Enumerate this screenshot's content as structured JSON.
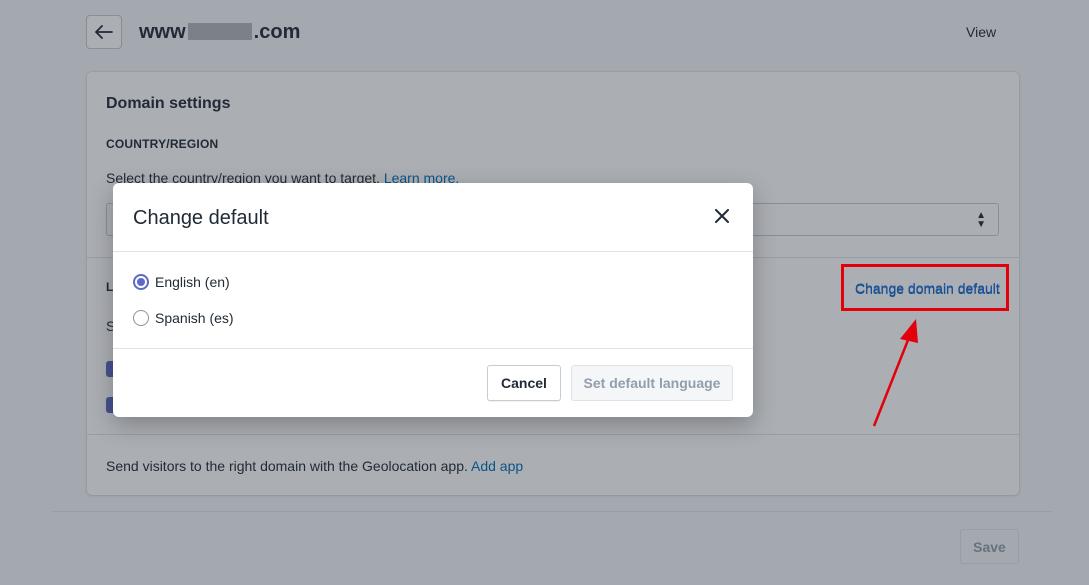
{
  "header": {
    "title_prefix": "www",
    "title_suffix": ".com",
    "view_label": "View"
  },
  "card": {
    "title": "Domain settings",
    "country_label": "COUNTRY/REGION",
    "country_text": "Select the country/region you want to target.",
    "learn_more": "Learn more.",
    "language_label_partial": "L",
    "language_text_partial": "S",
    "change_domain_default": "Change domain default",
    "geo_text": "Send visitors to the right domain with the Geolocation app.",
    "add_app": "Add app"
  },
  "footer": {
    "save_label": "Save"
  },
  "modal": {
    "title": "Change default",
    "options": [
      {
        "label": "English (en)",
        "checked": true
      },
      {
        "label": "Spanish (es)",
        "checked": false
      }
    ],
    "cancel_label": "Cancel",
    "set_default_label": "Set default language"
  },
  "colors": {
    "accent": "#5c6ac4",
    "link": "#006fbb",
    "annotation_red": "#e3000b"
  }
}
